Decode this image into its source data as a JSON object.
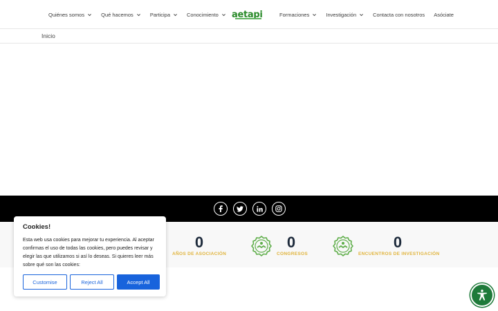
{
  "nav": {
    "left": [
      {
        "label": "Quiénes somos"
      },
      {
        "label": "Qué hacemos"
      },
      {
        "label": "Participa"
      },
      {
        "label": "Conocimiento"
      }
    ],
    "right": [
      {
        "label": "Formaciones",
        "dropdown": true
      },
      {
        "label": "Investigación",
        "dropdown": true
      },
      {
        "label": "Contacta con nosotros",
        "dropdown": false
      },
      {
        "label": "Asóciate",
        "dropdown": false
      }
    ]
  },
  "logo": {
    "text": "aetapi"
  },
  "breadcrumb": {
    "label": "Inicio"
  },
  "socials": [
    "facebook-icon",
    "twitter-icon",
    "linkedin-icon",
    "instagram-icon"
  ],
  "stats": [
    {
      "value": "0",
      "label": "AÑOS DE ASOCIACIÓN"
    },
    {
      "value": "0",
      "label": "CONGRESOS"
    },
    {
      "value": "0",
      "label": "ENCUENTROS DE INVESTIGACIÓN"
    }
  ],
  "cookie": {
    "title": "Cookies!",
    "text": "Esta web usa cookies para mejorar tu experiencia. Al aceptar confirmas el uso de todas las cookies, pero puedes revisar y elegir las que utilizamos si así lo deseas. Si quieres leer más sobre qué son las cookies:",
    "customise": "Customise",
    "reject": "Reject All",
    "accept": "Accept All"
  },
  "colors": {
    "brand_green": "#2a8a2a",
    "accent_gold": "#e0b33a",
    "button_blue": "#1863dc",
    "a11y_green": "#1e7a3a"
  }
}
